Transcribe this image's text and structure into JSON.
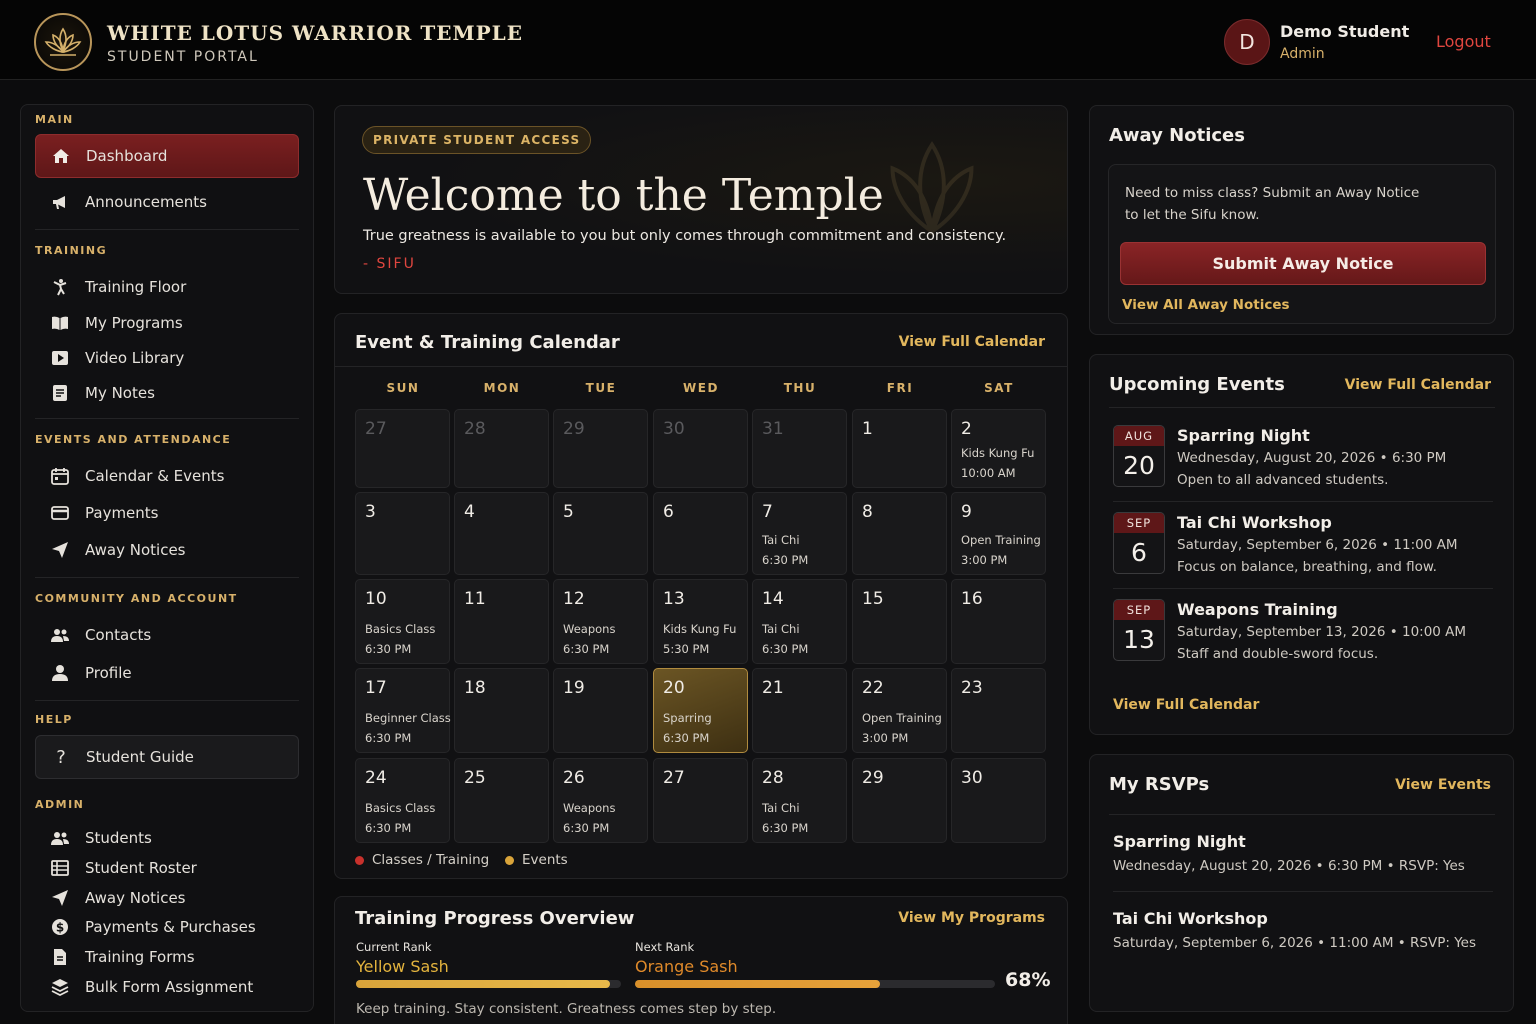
{
  "header": {
    "title": "White Lotus Warrior Temple",
    "subtitle": "STUDENT PORTAL",
    "avatar_initial": "D",
    "user_name": "Demo Student",
    "user_role": "Admin",
    "logout": "Logout"
  },
  "sidebar": {
    "sections": [
      {
        "heading": "MAIN",
        "items": [
          {
            "label": "Dashboard",
            "icon": "home-icon"
          },
          {
            "label": "Announcements",
            "icon": "megaphone-icon"
          }
        ]
      },
      {
        "heading": "TRAINING",
        "items": [
          {
            "label": "Training Floor",
            "icon": "martial-arts-icon"
          },
          {
            "label": "My Programs",
            "icon": "book-icon"
          },
          {
            "label": "Video Library",
            "icon": "play-icon"
          },
          {
            "label": "My Notes",
            "icon": "notes-icon"
          }
        ]
      },
      {
        "heading": "EVENTS AND ATTENDANCE",
        "items": [
          {
            "label": "Calendar & Events",
            "icon": "calendar-icon"
          },
          {
            "label": "Payments",
            "icon": "credit-card-icon"
          },
          {
            "label": "Away Notices",
            "icon": "paper-plane-icon"
          }
        ]
      },
      {
        "heading": "COMMUNITY AND ACCOUNT",
        "items": [
          {
            "label": "Contacts",
            "icon": "users-icon"
          },
          {
            "label": "Profile",
            "icon": "user-icon"
          }
        ]
      },
      {
        "heading": "HELP",
        "items": [
          {
            "label": "Student Guide",
            "icon": "question-icon"
          }
        ]
      },
      {
        "heading": "ADMIN",
        "items": [
          {
            "label": "Students",
            "icon": "users-icon"
          },
          {
            "label": "Student Roster",
            "icon": "roster-icon"
          },
          {
            "label": "Away Notices",
            "icon": "paper-plane-icon"
          },
          {
            "label": "Payments & Purchases",
            "icon": "dollar-icon"
          },
          {
            "label": "Training Forms",
            "icon": "document-icon"
          },
          {
            "label": "Bulk Form Assignment",
            "icon": "layers-icon"
          }
        ]
      }
    ]
  },
  "hero": {
    "pill": "PRIVATE STUDENT ACCESS",
    "title": "Welcome to the Temple",
    "quote": "True greatness is available to you but only comes through commitment and consistency.",
    "author": "- SIFU"
  },
  "calendar": {
    "title": "Event & Training Calendar",
    "link": "View Full Calendar",
    "days": [
      "SUN",
      "MON",
      "TUE",
      "WED",
      "THU",
      "FRI",
      "SAT"
    ],
    "weeks": [
      [
        {
          "n": "27",
          "m": true
        },
        {
          "n": "28",
          "m": true
        },
        {
          "n": "29",
          "m": true
        },
        {
          "n": "30",
          "m": true
        },
        {
          "n": "31",
          "m": true
        },
        {
          "n": "1"
        },
        {
          "n": "2",
          "e": "Kids Kung Fu",
          "t": "10:00 AM"
        }
      ],
      [
        {
          "n": "3"
        },
        {
          "n": "4"
        },
        {
          "n": "5"
        },
        {
          "n": "6"
        },
        {
          "n": "7",
          "e": "Tai Chi",
          "t": "6:30 PM"
        },
        {
          "n": "8"
        },
        {
          "n": "9",
          "e": "Open Training",
          "t": "3:00 PM"
        }
      ],
      [
        {
          "n": "10",
          "e": "Basics Class",
          "t": "6:30 PM"
        },
        {
          "n": "11"
        },
        {
          "n": "12",
          "e": "Weapons",
          "t": "6:30 PM"
        },
        {
          "n": "13",
          "e": "Kids Kung Fu",
          "t": "5:30 PM"
        },
        {
          "n": "14",
          "e": "Tai Chi",
          "t": "6:30 PM"
        },
        {
          "n": "15"
        },
        {
          "n": "16"
        }
      ],
      [
        {
          "n": "17",
          "e": "Beginner Class",
          "t": "6:30 PM"
        },
        {
          "n": "18"
        },
        {
          "n": "19"
        },
        {
          "n": "20",
          "e": "Sparring",
          "t": "6:30 PM",
          "today": true
        },
        {
          "n": "21"
        },
        {
          "n": "22",
          "e": "Open Training",
          "t": "3:00 PM"
        },
        {
          "n": "23"
        }
      ],
      [
        {
          "n": "24",
          "e": "Basics Class",
          "t": "6:30 PM"
        },
        {
          "n": "25"
        },
        {
          "n": "26",
          "e": "Weapons",
          "t": "6:30 PM"
        },
        {
          "n": "27"
        },
        {
          "n": "28",
          "e": "Tai Chi",
          "t": "6:30 PM"
        },
        {
          "n": "29"
        },
        {
          "n": "30"
        }
      ]
    ],
    "legend_classes": "Classes / Training",
    "legend_events": "Events",
    "colors": {
      "classes": "#c8312c",
      "events": "#d9a43a"
    }
  },
  "progress": {
    "title": "Training Progress Overview",
    "link": "View My Programs",
    "current_label": "Current Rank",
    "current_value": "Yellow Sash",
    "next_label": "Next Rank",
    "next_value": "Orange Sash",
    "percent": "68%",
    "percent_value": 0.68,
    "note": "Keep training. Stay consistent. Greatness comes step by step."
  },
  "away": {
    "title": "Away Notices",
    "text_1": "Need to miss class? Submit an Away Notice",
    "text_2": "to let the Sifu know.",
    "button": "Submit Away Notice",
    "link": "View All Away Notices"
  },
  "upcoming": {
    "title": "Upcoming Events",
    "link": "View Full Calendar",
    "bottom_link": "View Full Calendar",
    "items": [
      {
        "month": "AUG",
        "day": "20",
        "title": "Sparring Night",
        "when": "Wednesday, August 20, 2026 • 6:30 PM",
        "desc": "Open to all advanced students."
      },
      {
        "month": "SEP",
        "day": "6",
        "title": "Tai Chi Workshop",
        "when": "Saturday, September 6, 2026  • 11:00 AM",
        "desc": "Focus on balance, breathing, and flow."
      },
      {
        "month": "SEP",
        "day": "13",
        "title": "Weapons Training",
        "when": "Saturday, September 13, 2026  • 10:00 AM",
        "desc": "Staff and double-sword focus."
      }
    ]
  },
  "rsvps": {
    "title": "My RSVPs",
    "link": "View Events",
    "items": [
      {
        "title": "Sparring Night",
        "line": "Wednesday, August 20, 2026 • 6:30 PM • RSVP: Yes"
      },
      {
        "title": "Tai Chi Workshop",
        "line": "Saturday, September 6, 2026 • 11:00 AM • RSVP: Yes"
      }
    ]
  }
}
